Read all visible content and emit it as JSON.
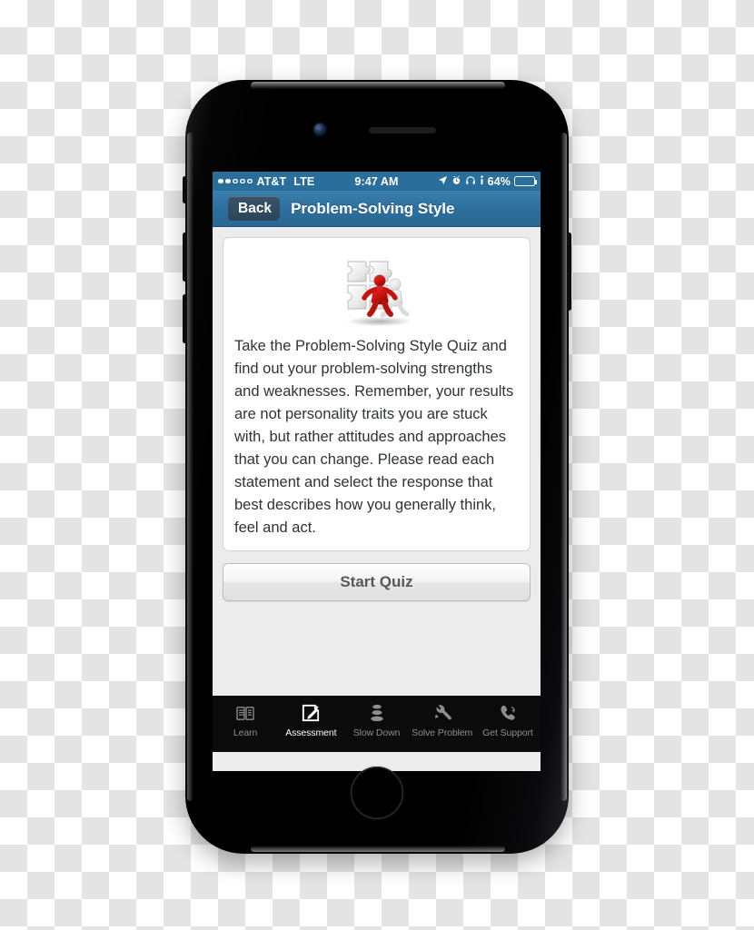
{
  "status_bar": {
    "signal_dots_filled": 2,
    "signal_dots_total": 5,
    "carrier": "AT&T",
    "network_type": "LTE",
    "time": "9:47 AM",
    "icons": [
      "location-arrow-icon",
      "alarm-clock-icon",
      "headphones-icon",
      "info-icon"
    ],
    "battery_percent": "64%",
    "battery_level": 64
  },
  "nav_bar": {
    "back_label": "Back",
    "title": "Problem-Solving Style",
    "bar_color": "#2d6f9c"
  },
  "card": {
    "image_name": "puzzle-pieces-illustration",
    "body": "Take the Problem-Solving Style Quiz and find out your problem-solving strengths and weaknesses. Remember, your results are not personality traits you are stuck with, but rather attitudes and approaches that you can change. Please read each statement and select the response that best describes how you generally think, feel and act."
  },
  "start_quiz_button": {
    "label": "Start Quiz"
  },
  "tab_bar": {
    "items": [
      {
        "label": "Learn",
        "icon": "book-icon",
        "active": false
      },
      {
        "label": "Assessment",
        "icon": "compose-icon",
        "active": true
      },
      {
        "label": "Slow Down",
        "icon": "stack-icon",
        "active": false
      },
      {
        "label": "Solve Problem",
        "icon": "wrench-icon",
        "active": false
      },
      {
        "label": "Get Support",
        "icon": "phone-icon",
        "active": false
      }
    ]
  }
}
